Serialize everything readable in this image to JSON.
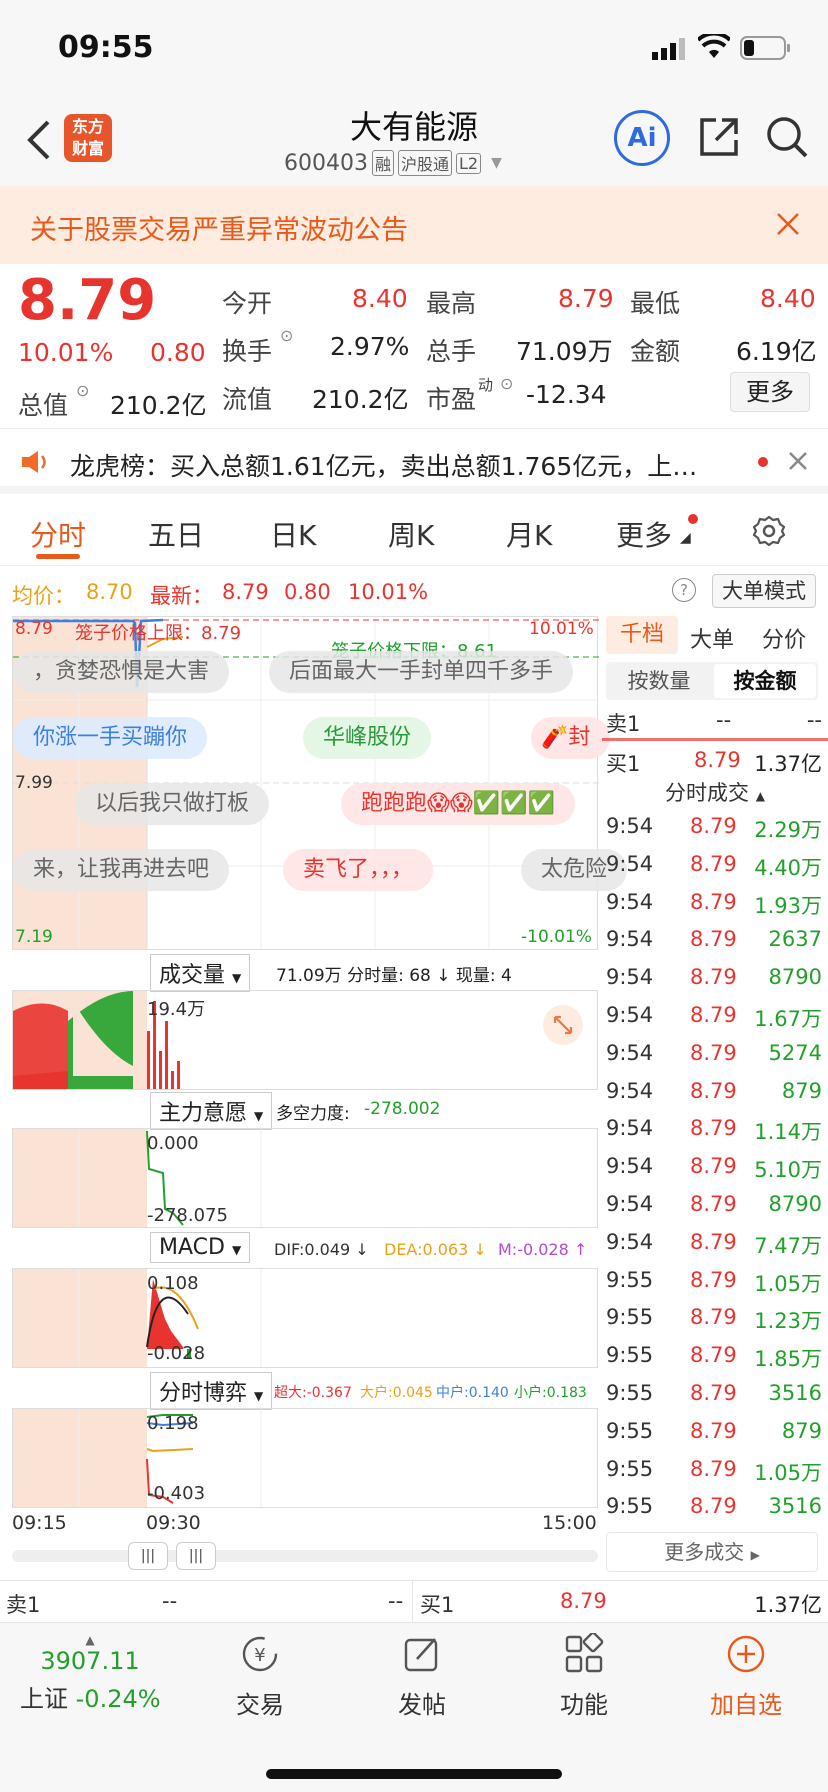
{
  "status": {
    "time": "09:55"
  },
  "header": {
    "logo_line1": "东方",
    "logo_line2": "财富",
    "stock_name": "大有能源",
    "stock_code": "600403",
    "tag_rong": "融",
    "tag_hgt": "沪股通",
    "tag_l2": "L2",
    "ai_label": "Ai"
  },
  "notice": {
    "text": "关于股票交易严重异常波动公告"
  },
  "quote": {
    "price": "8.79",
    "change_pct": "10.01%",
    "change": "0.80",
    "open_label": "今开",
    "open": "8.40",
    "high_label": "最高",
    "high": "8.79",
    "low_label": "最低",
    "low": "8.40",
    "turnover_label": "换手",
    "turnover": "2.97%",
    "volume_label": "总手",
    "volume": "71.09万",
    "amount_label": "金额",
    "amount": "6.19亿",
    "mktcap_label": "总值",
    "mktcap": "210.2亿",
    "float_label": "流值",
    "float": "210.2亿",
    "pe_label": "市盈",
    "pe_sup": "动",
    "pe": "-12.34",
    "more": "更多"
  },
  "lhb": {
    "text": "龙虎榜：买入总额1.61亿元，卖出总额1.765亿元，上…"
  },
  "tabs": [
    "分时",
    "五日",
    "日K",
    "周K",
    "月K",
    "更多"
  ],
  "chart_header": {
    "avg_label": "均价：",
    "avg": "8.70",
    "latest_label": "最新：",
    "latest": "8.79",
    "chg": "0.80",
    "pct": "10.01%",
    "big_mode": "大单模式"
  },
  "main_chart": {
    "price_top": "8.79",
    "upper_limit": "笼子价格上限：8.79",
    "lower_limit": "笼子价格下限：8.61",
    "pct_top": "10.01%",
    "mid_price": "7.99",
    "price_bottom": "7.19",
    "pct_bottom": "-10.01%"
  },
  "danmu": [
    "，贪婪恐惧是大害",
    "后面最大一手封单四千多手",
    "你涨一手买蹦你",
    "华峰股份",
    "封",
    "以后我只做打板",
    "跑跑跑😱😱✅✅✅",
    "来，让我再进去吧",
    "卖飞了，，，",
    "太危险"
  ],
  "volume_panel": {
    "selector": "成交量",
    "summary": "71.09万 分时量: 68 ↓ 现量: 4",
    "axis_top": "19.4万"
  },
  "force_panel": {
    "selector": "主力意愿",
    "label": "多空力度:",
    "value": "-278.002",
    "axis_top": "0.000",
    "axis_bottom": "-278.075"
  },
  "macd_panel": {
    "selector": "MACD",
    "dif": "DIF:0.049 ↓",
    "dea": "DEA:0.063 ↓",
    "m": "M:-0.028 ↑",
    "axis_top": "0.108",
    "axis_bottom": "-0.028"
  },
  "game_panel": {
    "selector": "分时博弈",
    "super": "超大:-0.367",
    "big": "大户:0.045",
    "mid": "中户:0.140",
    "small": "小户:0.183",
    "axis_top": "0.198",
    "axis_bottom": "-0.403"
  },
  "time_axis": {
    "start": "09:15",
    "mid": "09:30",
    "end": "15:00"
  },
  "right_panel": {
    "tab1": "千档",
    "tab2": "大单",
    "tab3": "分价",
    "sub1": "按数量",
    "sub2": "按金额",
    "sell1_label": "卖1",
    "sell1_price": "--",
    "sell1_vol": "--",
    "buy1_label": "买1",
    "buy1_price": "8.79",
    "buy1_vol": "1.37亿",
    "ticks_title": "分时成交",
    "more": "更多成交"
  },
  "ticks": [
    {
      "t": "9:54",
      "p": "8.79",
      "v": "2.29万"
    },
    {
      "t": "9:54",
      "p": "8.79",
      "v": "4.40万"
    },
    {
      "t": "9:54",
      "p": "8.79",
      "v": "1.93万"
    },
    {
      "t": "9:54",
      "p": "8.79",
      "v": "2637"
    },
    {
      "t": "9:54",
      "p": "8.79",
      "v": "8790"
    },
    {
      "t": "9:54",
      "p": "8.79",
      "v": "1.67万"
    },
    {
      "t": "9:54",
      "p": "8.79",
      "v": "5274"
    },
    {
      "t": "9:54",
      "p": "8.79",
      "v": "879"
    },
    {
      "t": "9:54",
      "p": "8.79",
      "v": "1.14万"
    },
    {
      "t": "9:54",
      "p": "8.79",
      "v": "5.10万"
    },
    {
      "t": "9:54",
      "p": "8.79",
      "v": "8790"
    },
    {
      "t": "9:54",
      "p": "8.79",
      "v": "7.47万"
    },
    {
      "t": "9:55",
      "p": "8.79",
      "v": "1.05万"
    },
    {
      "t": "9:55",
      "p": "8.79",
      "v": "1.23万"
    },
    {
      "t": "9:55",
      "p": "8.79",
      "v": "1.85万"
    },
    {
      "t": "9:55",
      "p": "8.79",
      "v": "3516"
    },
    {
      "t": "9:55",
      "p": "8.79",
      "v": "879"
    },
    {
      "t": "9:55",
      "p": "8.79",
      "v": "1.05万"
    },
    {
      "t": "9:55",
      "p": "8.79",
      "v": "3516"
    }
  ],
  "bottom_order": {
    "sell1_label": "卖1",
    "sell1_price": "--",
    "sell1_vol": "--",
    "buy1_label": "买1",
    "buy1_price": "8.79",
    "buy1_vol": "1.37亿"
  },
  "bottom_nav": {
    "index_value": "3907.11",
    "index_name": "上证",
    "index_chg": "-0.24%",
    "trade": "交易",
    "post": "发帖",
    "func": "功能",
    "add": "加自选"
  }
}
